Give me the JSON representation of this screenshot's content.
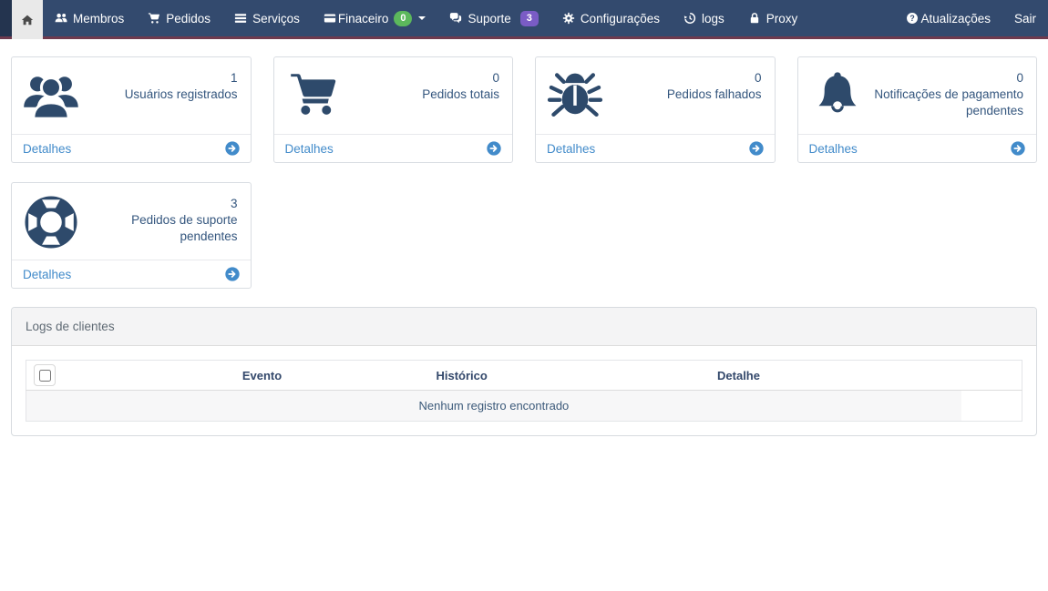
{
  "navbar": {
    "items": [
      {
        "label": "",
        "icon": "home-icon",
        "active": true
      },
      {
        "label": "Membros",
        "icon": "users-icon"
      },
      {
        "label": "Pedidos",
        "icon": "cart-icon"
      },
      {
        "label": "Serviços",
        "icon": "list-icon"
      },
      {
        "label": "Finaceiro",
        "icon": "credit-card-icon",
        "badge": "0",
        "has_caret": true
      },
      {
        "label": "Suporte",
        "icon": "comments-icon",
        "badge": "3"
      },
      {
        "label": "Configurações",
        "icon": "gear-icon"
      },
      {
        "label": "logs",
        "icon": "history-icon"
      },
      {
        "label": "Proxy",
        "icon": "lock-icon"
      }
    ],
    "right_items": [
      {
        "label": "Atualizações",
        "icon": "question-circle-icon"
      },
      {
        "label": "Sair"
      }
    ]
  },
  "cards": [
    {
      "value": "1",
      "label": "Usuários registrados",
      "icon": "users-icon",
      "link_label": "Detalhes"
    },
    {
      "value": "0",
      "label": "Pedidos totais",
      "icon": "cart-icon",
      "link_label": "Detalhes"
    },
    {
      "value": "0",
      "label": "Pedidos falhados",
      "icon": "bug-icon",
      "link_label": "Detalhes"
    },
    {
      "value": "0",
      "label": "Notificações de pagamento pendentes",
      "icon": "bell-icon",
      "link_label": "Detalhes"
    },
    {
      "value": "3",
      "label": "Pedidos de suporte pendentes",
      "icon": "life-ring-icon",
      "link_label": "Detalhes"
    }
  ],
  "logs_panel": {
    "title": "Logs de clientes",
    "table": {
      "headers": [
        "Evento",
        "Histórico",
        "Detalhe"
      ],
      "empty_message": "Nenhum registro encontrado"
    }
  },
  "colors": {
    "navbar_bg": "#334a6e",
    "navbar_accent_line": "#6f3a4e",
    "badge_green": "#5cb85c",
    "badge_purple": "#7a5cc5",
    "link_blue": "#428bca",
    "stat_navy": "#2e4a6b"
  }
}
